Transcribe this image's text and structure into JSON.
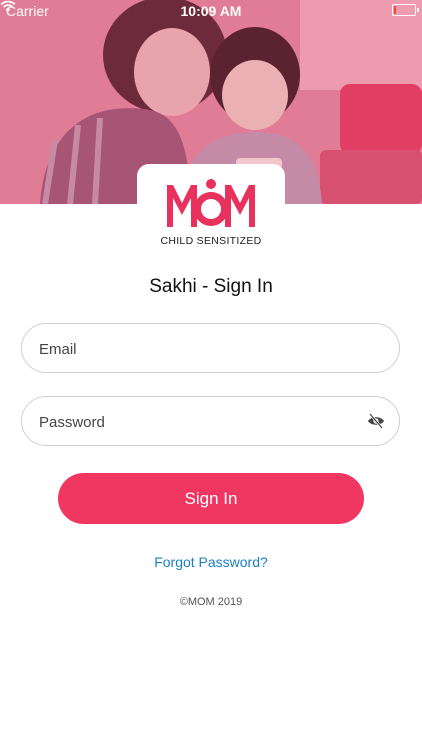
{
  "status_bar": {
    "carrier": "Carrier",
    "time": "10:09 AM",
    "battery_level": 0.1
  },
  "logo": {
    "brand": "MOM",
    "tagline": "CHILD SENSITIZED"
  },
  "title": "Sakhi - Sign In",
  "form": {
    "email_placeholder": "Email",
    "email_value": "",
    "password_placeholder": "Password",
    "password_value": "",
    "password_toggle_icon": "eye-slash-icon",
    "signin_label": "Sign In",
    "forgot_label": "Forgot Password?"
  },
  "footer": {
    "copyright": "©MOM 2019"
  },
  "colors": {
    "accent": "#f03762",
    "link": "#1a7fc1",
    "hero_tint": "#e07a92",
    "border": "#d0d0d0"
  }
}
